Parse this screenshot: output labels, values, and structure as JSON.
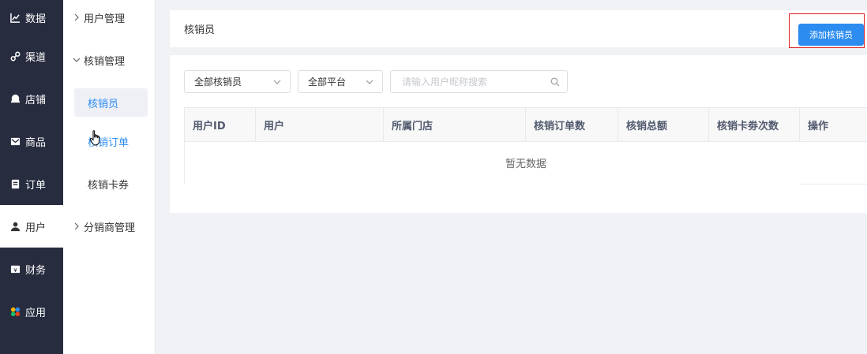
{
  "main_nav": {
    "items": [
      {
        "label": "数据",
        "icon": "chart-line-icon",
        "active": false
      },
      {
        "label": "渠道",
        "icon": "link-icon",
        "active": false
      },
      {
        "label": "店铺",
        "icon": "store-icon",
        "active": false
      },
      {
        "label": "商品",
        "icon": "envelope-icon",
        "active": false
      },
      {
        "label": "订单",
        "icon": "clipboard-icon",
        "active": false
      },
      {
        "label": "用户",
        "icon": "user-icon",
        "active": true
      },
      {
        "label": "财务",
        "icon": "money-icon",
        "active": false
      },
      {
        "label": "应用",
        "icon": "apps-icon",
        "active": false
      }
    ]
  },
  "sub_nav": {
    "user_management": "用户管理",
    "verification_management": "核销管理",
    "verifier": "核销员",
    "verification_order": "核销订单",
    "verification_coupon": "核销卡券",
    "distributor_management": "分销商管理"
  },
  "header": {
    "title": "核销员",
    "add_button": "添加核销员"
  },
  "filters": {
    "verifier_select": "全部核销员",
    "platform_select": "全部平台",
    "search_placeholder": "请输入用户昵称搜索"
  },
  "table": {
    "columns": [
      "用户ID",
      "用户",
      "所属门店",
      "核销订单数",
      "核销总额",
      "核销卡劵次数",
      "操作"
    ],
    "empty_text": "暂无数据"
  },
  "colors": {
    "sidebar_bg": "#282c3f",
    "primary": "#2d8cf0",
    "highlight_border": "#e01b1b"
  }
}
